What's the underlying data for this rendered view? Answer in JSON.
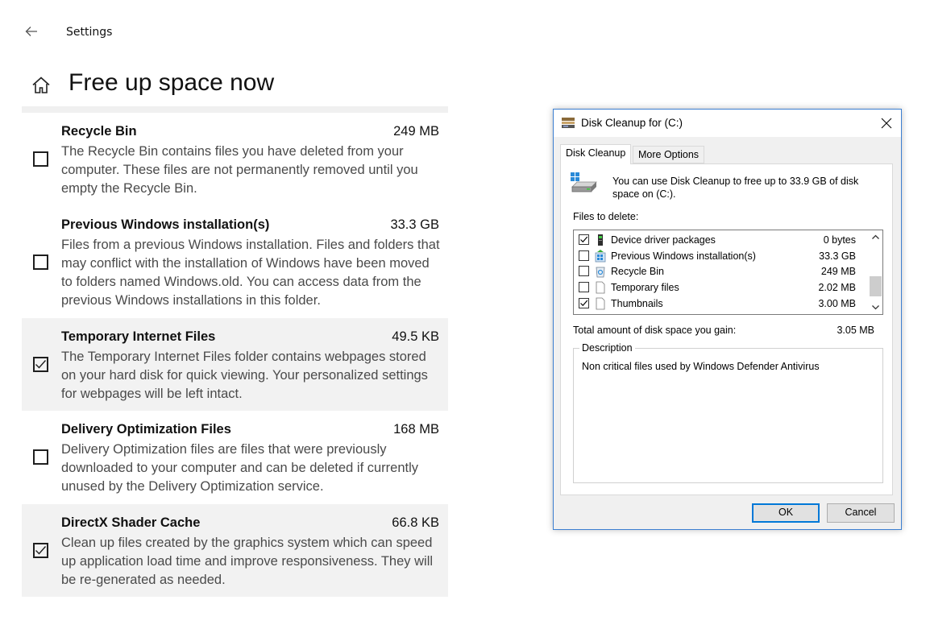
{
  "settings": {
    "header_label": "Settings",
    "page_title": "Free up space now",
    "items": [
      {
        "name": "Recycle Bin",
        "size": "249 MB",
        "checked": false,
        "description": "The Recycle Bin contains files you have deleted from your computer. These files are not permanently removed until you empty the Recycle Bin."
      },
      {
        "name": "Previous Windows installation(s)",
        "size": "33.3 GB",
        "checked": false,
        "description": "Files from a previous Windows installation.  Files and folders that may conflict with the installation of Windows have been moved to folders named Windows.old.  You can access data from the previous Windows installations in this folder."
      },
      {
        "name": "Temporary Internet Files",
        "size": "49.5 KB",
        "checked": true,
        "description": "The Temporary Internet Files folder contains webpages stored on your hard disk for quick viewing. Your personalized settings for webpages will be left intact."
      },
      {
        "name": "Delivery Optimization Files",
        "size": "168 MB",
        "checked": false,
        "description": "Delivery Optimization files are files that were previously downloaded to your computer and can be deleted if currently unused by the Delivery Optimization service."
      },
      {
        "name": "DirectX Shader Cache",
        "size": "66.8 KB",
        "checked": true,
        "description": "Clean up files created by the graphics system which can speed up application load time and improve responsiveness. They will be re-generated as needed."
      }
    ]
  },
  "dialog": {
    "title": "Disk Cleanup for  (C:)",
    "tabs": [
      "Disk Cleanup",
      "More Options"
    ],
    "intro": "You can use Disk Cleanup to free up to 33.9 GB of disk space on  (C:).",
    "files_label": "Files to delete:",
    "files": [
      {
        "name": "Device driver packages",
        "size": "0 bytes",
        "checked": true,
        "icon": "driver-icon"
      },
      {
        "name": "Previous Windows installation(s)",
        "size": "33.3 GB",
        "checked": false,
        "icon": "windows-installation-icon"
      },
      {
        "name": "Recycle Bin",
        "size": "249 MB",
        "checked": false,
        "icon": "recycle-bin-icon"
      },
      {
        "name": "Temporary files",
        "size": "2.02 MB",
        "checked": false,
        "icon": "file-icon"
      },
      {
        "name": "Thumbnails",
        "size": "3.00 MB",
        "checked": true,
        "icon": "file-icon"
      }
    ],
    "total_label": "Total amount of disk space you gain:",
    "total_value": "3.05 MB",
    "description_legend": "Description",
    "description_text": "Non critical files used by Windows Defender Antivirus",
    "ok_label": "OK",
    "cancel_label": "Cancel"
  },
  "colors": {
    "accent": "#0078d7",
    "selected_row": "#f2f2f2"
  }
}
